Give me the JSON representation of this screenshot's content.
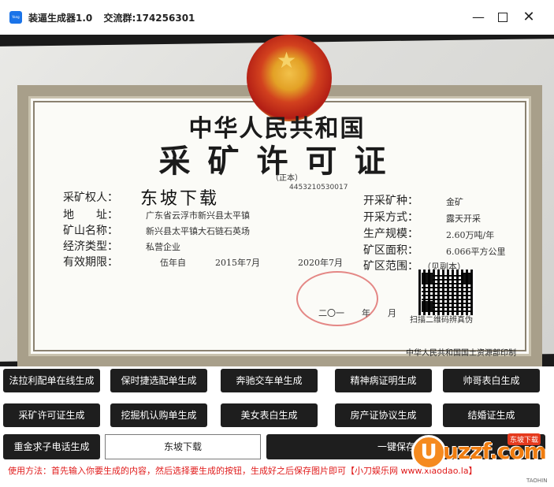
{
  "window": {
    "app_name": "装逼生成器1.0",
    "group_label": "交流群:174256301",
    "icon_label": "Yang Space",
    "minimize_glyph": "—",
    "close_glyph": "✕"
  },
  "certificate": {
    "title_line1": "中华人民共和国",
    "title_line2": "采矿许可证",
    "subtitle": "（正本）",
    "code": "4453210530017",
    "left_labels": [
      "采矿权人：",
      "地　　址：",
      "矿山名称：",
      "经济类型：",
      "有效期限："
    ],
    "right_labels": [
      "开采矿种：",
      "开采方式：",
      "生产规模：",
      "矿区面积：",
      "矿区范围："
    ],
    "holder_name": "东坡下载",
    "address": "广东省云浮市新兴县太平镇",
    "mine_name": "新兴县太平镇大石链石英场",
    "economy_type": "私营企业",
    "validity_term": "伍年自",
    "validity_start": "2015年7月",
    "validity_end": "2020年7月",
    "mineral": "金矿",
    "method": "露天开采",
    "scale": "2.60万吨/年",
    "area": "6.066平方公里",
    "range": "（见副本）",
    "qr_caption": "扫描二维码辨真伪",
    "issue_year": "二〇一　　年　　月",
    "issuer": "中华人民共和国国土资源部印制"
  },
  "buttons_row1": [
    "法拉利配单在线生成",
    "保时捷选配单生成",
    "奔驰交车单生成",
    "精神病证明生成",
    "帅哥表白生成"
  ],
  "buttons_row2": [
    "采矿许可证生成",
    "挖掘机认购单生成",
    "美女表白生成",
    "房产证协议生成",
    "结婚证生成"
  ],
  "buttons_row3": {
    "phone": "重金求子电话生成",
    "save": "一键保存图片"
  },
  "name_input": {
    "value": "东坡下载"
  },
  "usage_text": "使用方法：首先输入你要生成的内容，然后选择要生成的按钮，生成好之后保存图片即可【小刀娱乐网 www.xiaodao.la】",
  "watermark": {
    "letter": "U",
    "brand": "uzzf.com",
    "tag": "东坡下载"
  },
  "corner_text": "TAOHIN"
}
